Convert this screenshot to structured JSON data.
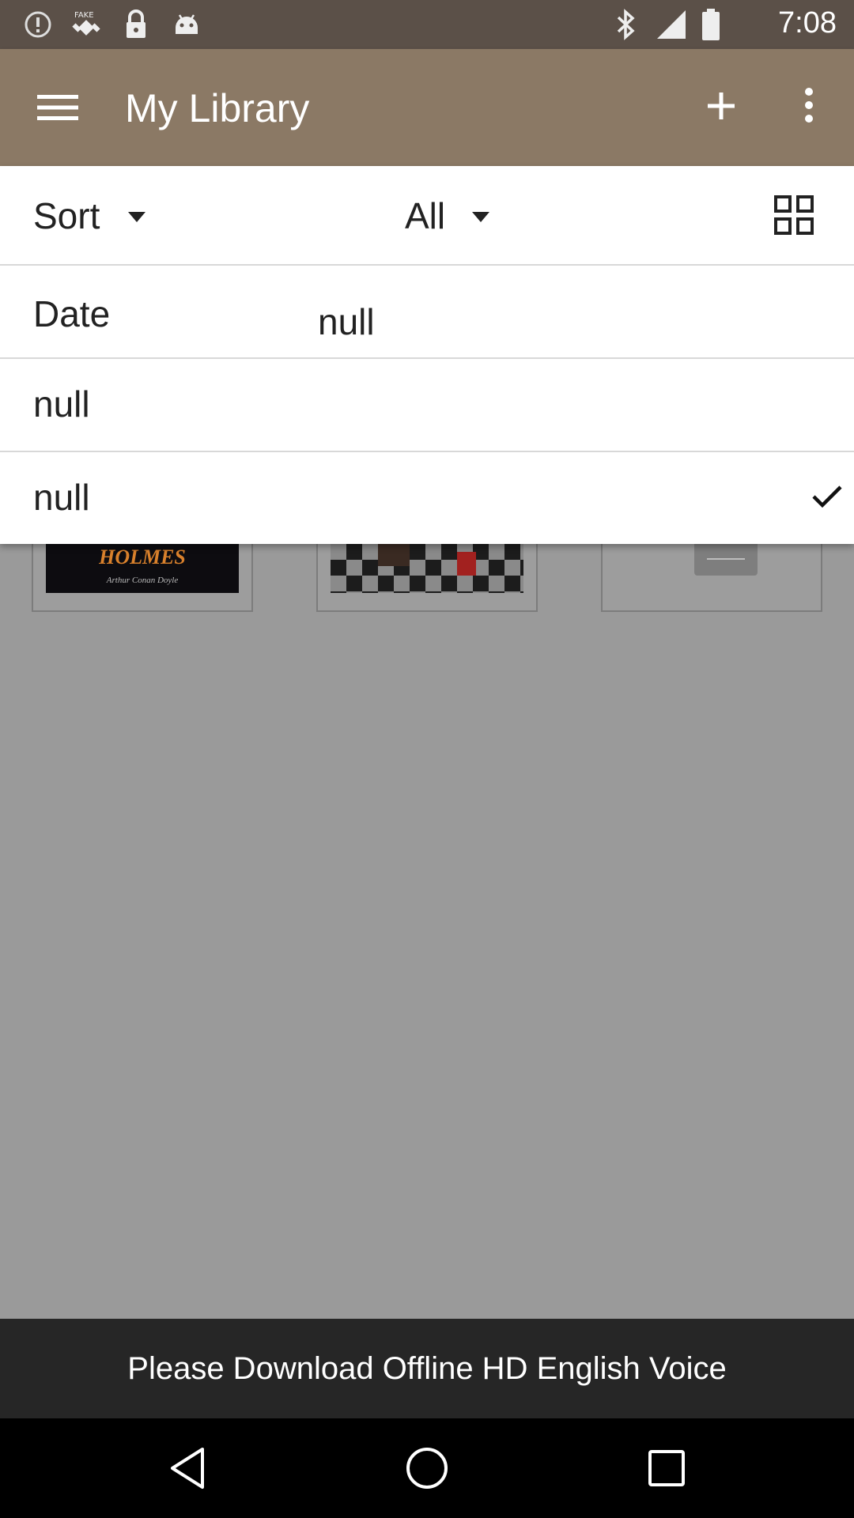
{
  "status_bar": {
    "time": "7:08",
    "icons": [
      "info-circle-icon",
      "fake-gps-icon",
      "lock-icon",
      "android-icon",
      "bluetooth-icon",
      "signal-icon",
      "battery-icon"
    ]
  },
  "app_bar": {
    "title": "My Library",
    "menu_icon": "hamburger-menu-icon",
    "add_icon": "plus-icon",
    "overflow_icon": "more-vert-icon",
    "background": "#8b7965"
  },
  "toolbar": {
    "sort_label": "Sort",
    "filter_label": "All",
    "view_icon": "grid-view-icon"
  },
  "sort_menu": {
    "items": [
      {
        "label": "Date",
        "value": "null"
      },
      {
        "label": "null"
      },
      {
        "label": "null",
        "checked": true
      }
    ],
    "check_icon": "checkmark-icon"
  },
  "shelf": {
    "books": [
      {
        "cover_text": "HOLMES",
        "cover_subtext": "Arthur Conan Doyle"
      },
      {
        "cover_text": ""
      },
      {
        "cover_text": ""
      }
    ]
  },
  "banner": {
    "text": "Please Download Offline HD English Voice"
  },
  "nav_bar": {
    "icons": [
      "back-icon",
      "home-icon",
      "recents-icon"
    ]
  }
}
